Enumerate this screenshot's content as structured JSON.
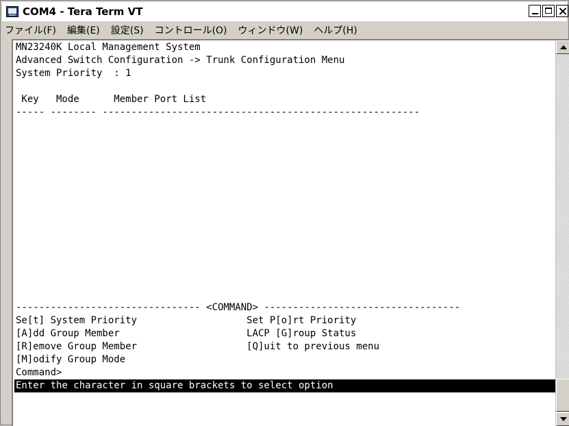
{
  "window": {
    "title": "COM4 - Tera Term VT"
  },
  "menu": [
    "ファイル(F)",
    "編集(E)",
    "設定(S)",
    "コントロール(O)",
    "ウィンドウ(W)",
    "ヘルプ(H)"
  ],
  "terminal": {
    "header_line1": "MN23240K Local Management System",
    "header_line2": "Advanced Switch Configuration -> Trunk Configuration Menu",
    "system_priority": "System Priority  : 1",
    "columns": " Key   Mode      Member Port List",
    "columns_rule": "----- -------- -------------------------------------------------------",
    "command_rule": "-------------------------------- <COMMAND> ----------------------------------",
    "commands_row1": "Se[t] System Priority                   Set P[o]rt Priority",
    "commands_row2": "[A]dd Group Member                      LACP [G]roup Status",
    "commands_row3": "[R]emove Group Member                   [Q]uit to previous menu",
    "commands_row4": "[M]odify Group Mode",
    "prompt": "Command>",
    "status": "Enter the character in square brackets to select option"
  }
}
